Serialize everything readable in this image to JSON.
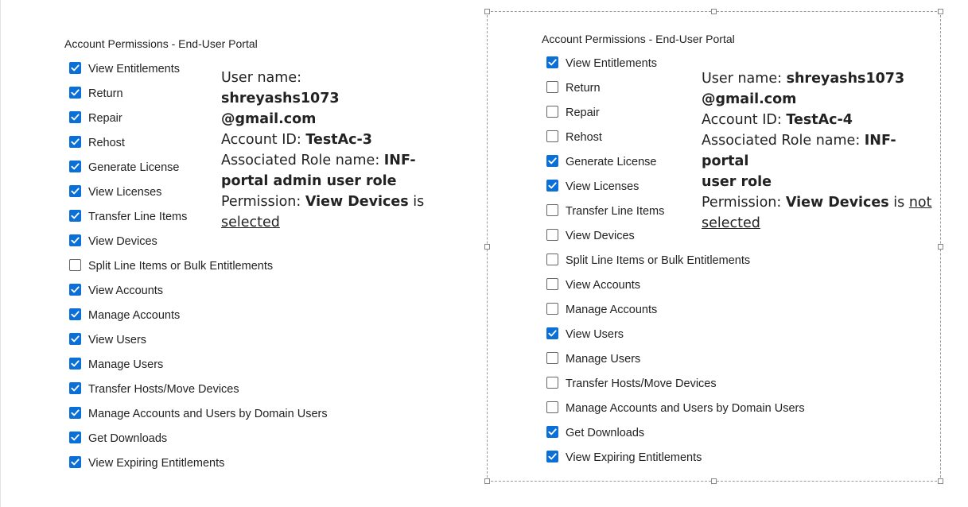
{
  "left_panel": {
    "title": "Account Permissions - End-User Portal",
    "permissions": [
      {
        "label": "View Entitlements",
        "checked": true
      },
      {
        "label": "Return",
        "checked": true
      },
      {
        "label": "Repair",
        "checked": true
      },
      {
        "label": "Rehost",
        "checked": true
      },
      {
        "label": "Generate License",
        "checked": true
      },
      {
        "label": "View Licenses",
        "checked": true
      },
      {
        "label": "Transfer Line Items",
        "checked": true
      },
      {
        "label": "View Devices",
        "checked": true
      },
      {
        "label": "Split Line Items or Bulk Entitlements",
        "checked": false
      },
      {
        "label": "View Accounts",
        "checked": true
      },
      {
        "label": "Manage Accounts",
        "checked": true
      },
      {
        "label": "View Users",
        "checked": true
      },
      {
        "label": "Manage Users",
        "checked": true
      },
      {
        "label": "Transfer Hosts/Move Devices",
        "checked": true
      },
      {
        "label": "Manage Accounts and Users by Domain Users",
        "checked": true
      },
      {
        "label": "Get Downloads",
        "checked": true
      },
      {
        "label": "View Expiring Entitlements",
        "checked": true
      }
    ],
    "info": {
      "user_name_label": "User name:",
      "user_name_part1": "shreyashs1073",
      "user_name_part2": "@gmail.com",
      "account_id_label": "Account ID:",
      "account_id_value": "TestAc-3",
      "role_label": "Associated Role name:",
      "role_value_part1": "INF-",
      "role_value_part2": "portal admin user role",
      "permission_label": "Permission:",
      "permission_value": "View Devices",
      "permission_is": "is",
      "permission_status": "selected"
    }
  },
  "right_panel": {
    "title": "Account Permissions - End-User Portal",
    "permissions": [
      {
        "label": "View Entitlements",
        "checked": true
      },
      {
        "label": "Return",
        "checked": false
      },
      {
        "label": "Repair",
        "checked": false
      },
      {
        "label": "Rehost",
        "checked": false
      },
      {
        "label": "Generate License",
        "checked": true
      },
      {
        "label": "View Licenses",
        "checked": true
      },
      {
        "label": "Transfer Line Items",
        "checked": false
      },
      {
        "label": "View Devices",
        "checked": false
      },
      {
        "label": "Split Line Items or Bulk Entitlements",
        "checked": false
      },
      {
        "label": "View Accounts",
        "checked": false
      },
      {
        "label": "Manage Accounts",
        "checked": false
      },
      {
        "label": "View Users",
        "checked": true
      },
      {
        "label": "Manage Users",
        "checked": false
      },
      {
        "label": "Transfer Hosts/Move Devices",
        "checked": false
      },
      {
        "label": "Manage Accounts and Users by Domain Users",
        "checked": false
      },
      {
        "label": "Get Downloads",
        "checked": true
      },
      {
        "label": "View Expiring Entitlements",
        "checked": true
      }
    ],
    "info": {
      "user_name_label": "User name:",
      "user_name_part1": "shreyashs1073",
      "user_name_part2": "@gmail.com",
      "account_id_label": "Account ID:",
      "account_id_value": "TestAc-4",
      "role_label": "Associated Role name:",
      "role_value_part1": "INF-portal",
      "role_value_part2": "user role",
      "permission_label": "Permission:",
      "permission_value": "View Devices",
      "permission_is": "is",
      "permission_status_part1": "not",
      "permission_status_part2": "selected"
    }
  },
  "colors": {
    "checkbox_checked": "#0b6fd8",
    "text": "#222222",
    "selection_border": "#9a9a9a"
  }
}
